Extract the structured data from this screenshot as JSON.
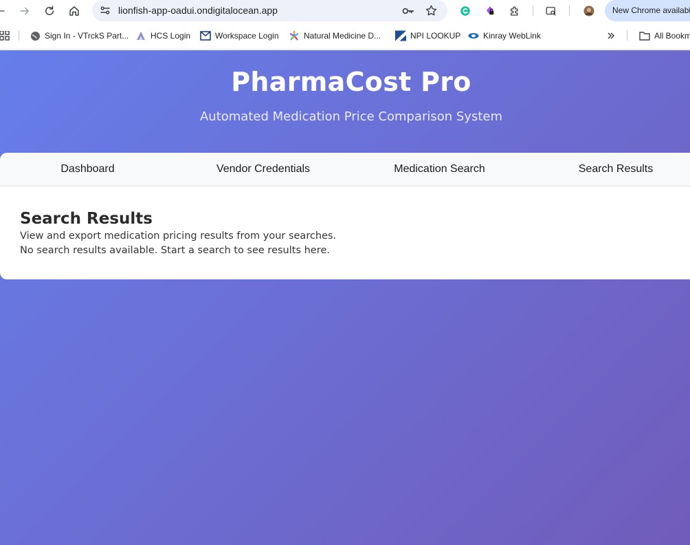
{
  "browser": {
    "url": "lionfish-app-oadui.ondigitalocean.app",
    "update_chip": "New Chrome available",
    "icons": [
      "back-icon",
      "forward-icon",
      "reload-icon",
      "home-icon",
      "site-info-icon",
      "password-key-icon",
      "bookmark-star-icon",
      "grammarly-icon",
      "extension-lock-icon",
      "extensions-puzzle-icon",
      "search-tab-icon",
      "profile-avatar"
    ]
  },
  "bookmarks": {
    "items": [
      {
        "label": "Sign In - VTrckS Part...",
        "icon": "globe-icon"
      },
      {
        "label": "HCS Login",
        "icon": "hcs-icon"
      },
      {
        "label": "Workspace Login",
        "icon": "mail-icon"
      },
      {
        "label": "Natural Medicine D...",
        "icon": "natural-medicine-icon"
      },
      {
        "label": "NPI LOOKUP",
        "icon": "npi-icon"
      },
      {
        "label": "Kinray WebLink",
        "icon": "kinray-icon"
      }
    ],
    "all_bookmarks": "All Bookmarks"
  },
  "app": {
    "title": "PharmaCost Pro",
    "subtitle": "Automated Medication Price Comparison System"
  },
  "nav": {
    "tabs": [
      {
        "label": "Dashboard"
      },
      {
        "label": "Vendor Credentials"
      },
      {
        "label": "Medication Search"
      },
      {
        "label": "Search Results"
      }
    ],
    "active": "Search Results"
  },
  "results": {
    "title": "Search Results",
    "description": "View and export medication pricing results from your searches.",
    "empty_message": "No search results available. Start a search to see results here."
  },
  "colors": {
    "gradient_start": "#667eea",
    "gradient_end": "#764ba2",
    "omnibox": "#edf2fa",
    "update_chip": "#d3e3fd"
  }
}
